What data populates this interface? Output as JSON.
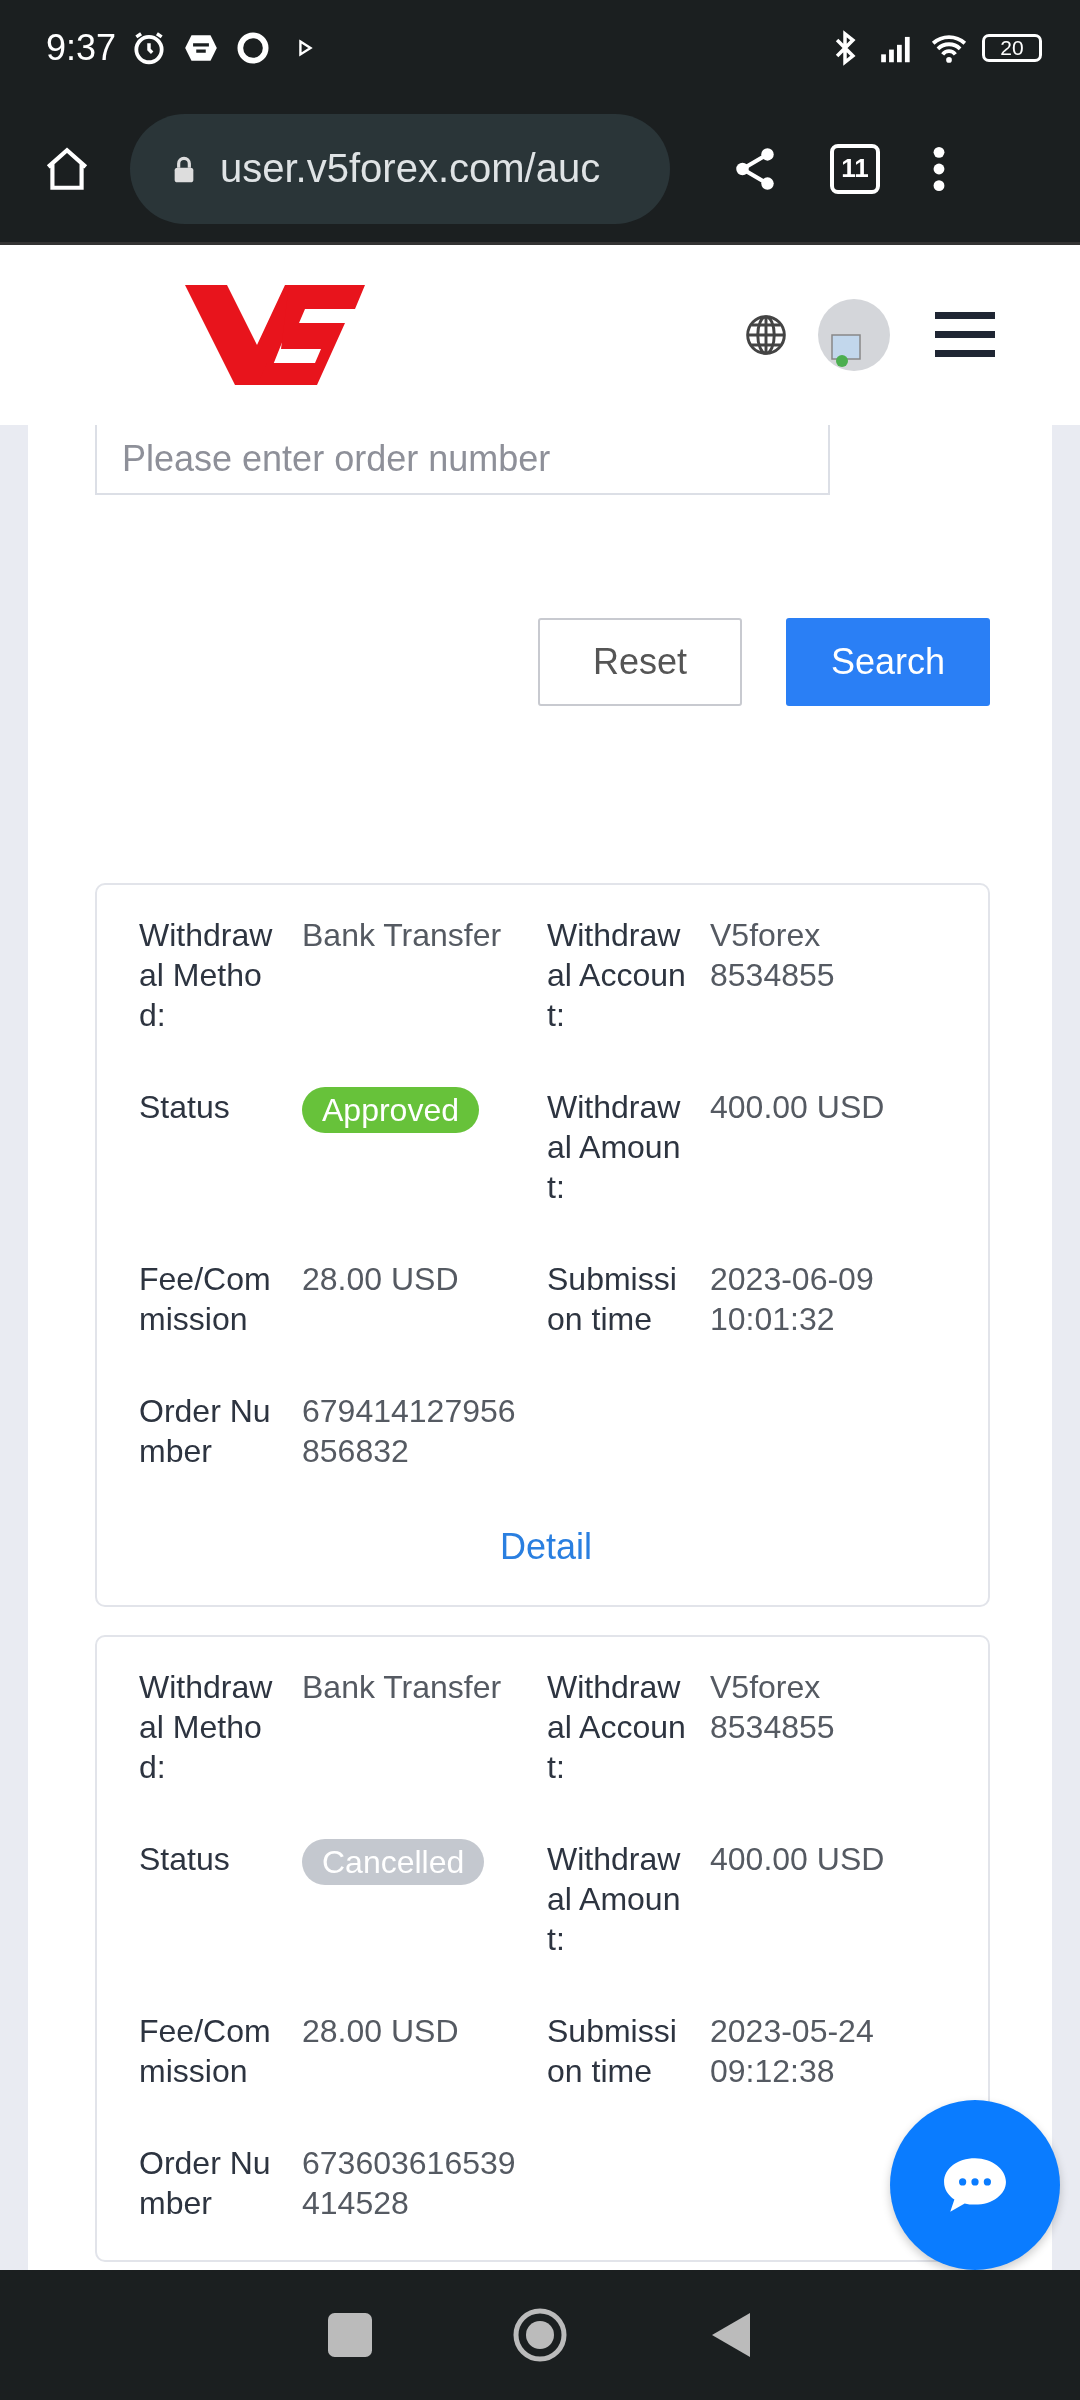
{
  "status_bar": {
    "time": "9:37",
    "battery": "20"
  },
  "browser": {
    "url": "user.v5forex.com/auc",
    "tab_count": "11"
  },
  "search": {
    "placeholder": "Please enter order number"
  },
  "buttons": [
    {
      "label": "Reset",
      "kind": "secondary"
    },
    {
      "label": "Search",
      "kind": "primary"
    }
  ],
  "cards": [
    {
      "fields": [
        {
          "label": "Withdrawal Method:",
          "value": "Bank Transfer"
        },
        {
          "label": "Withdrawal Account:",
          "value": "V5forex 8534855"
        },
        {
          "label": "Status",
          "value": "Approved",
          "kind": "badge",
          "color": "#67c23a"
        },
        {
          "label": "Withdrawal Amount:",
          "value": "400.00 USD"
        },
        {
          "label": "Fee/Commission",
          "value": "28.00 USD"
        },
        {
          "label": "Submission time",
          "value": "2023-06-09 10:01:32"
        },
        {
          "label": "Order Number",
          "value": "679414127956856832"
        }
      ],
      "detail_link": "Detail"
    },
    {
      "fields": [
        {
          "label": "Withdrawal Method:",
          "value": "Bank Transfer"
        },
        {
          "label": "Withdrawal Account:",
          "value": "V5forex 8534855"
        },
        {
          "label": "Status",
          "value": "Cancelled",
          "kind": "badge",
          "color": "#c4c8cf"
        },
        {
          "label": "Withdrawal Amount:",
          "value": "400.00 USD"
        },
        {
          "label": "Fee/Commission",
          "value": "28.00 USD"
        },
        {
          "label": "Submission time",
          "value": "2023-05-24 09:12:38"
        },
        {
          "label": "Order Number",
          "value": "673603616539414528"
        }
      ]
    }
  ]
}
